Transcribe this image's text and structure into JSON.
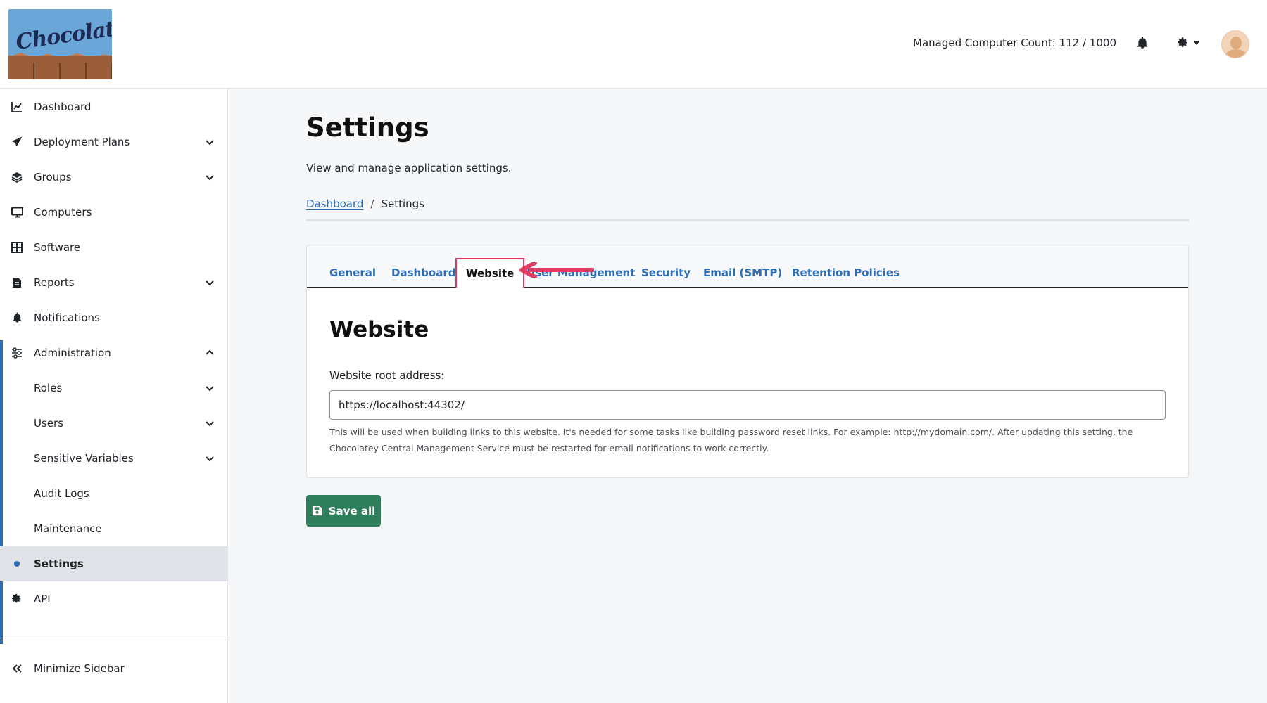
{
  "header": {
    "logo_text": "Chocolatey",
    "managed_count": "Managed Computer Count: 112 / 1000"
  },
  "sidebar": {
    "items": [
      {
        "label": "Dashboard",
        "icon": "chart-line-icon"
      },
      {
        "label": "Deployment Plans",
        "icon": "paper-plane-icon"
      },
      {
        "label": "Groups",
        "icon": "layers-icon"
      },
      {
        "label": "Computers",
        "icon": "desktop-icon"
      },
      {
        "label": "Software",
        "icon": "grid-icon"
      },
      {
        "label": "Reports",
        "icon": "report-file-icon"
      },
      {
        "label": "Notifications",
        "icon": "bell-icon"
      },
      {
        "label": "Administration",
        "icon": "sliders-icon"
      },
      {
        "label": "Roles"
      },
      {
        "label": "Users"
      },
      {
        "label": "Sensitive Variables"
      },
      {
        "label": "Audit Logs"
      },
      {
        "label": "Maintenance"
      },
      {
        "label": "Settings"
      },
      {
        "label": "API",
        "icon": "gear-icon"
      }
    ],
    "minimize_label": "Minimize Sidebar"
  },
  "main": {
    "title": "Settings",
    "subtitle": "View and manage application settings.",
    "breadcrumb": {
      "home": "Dashboard",
      "separator": "/",
      "current": "Settings"
    },
    "tabs": [
      {
        "label": "General"
      },
      {
        "label": "Dashboard"
      },
      {
        "label": "Website"
      },
      {
        "label": "User Management"
      },
      {
        "label": "Security"
      },
      {
        "label": "Email (SMTP)"
      },
      {
        "label": "Retention Policies"
      }
    ],
    "active_tab": "Website",
    "section_title": "Website",
    "field_label": "Website root address:",
    "field_value": "https://localhost:44302/",
    "help_text": "This will be used when building links to this website. It's needed for some tasks like building password reset links. For example: http://mydomain.com/. After updating this setting, the Chocolatey Central Management Service must be restarted for email notifications to work correctly.",
    "save_label": "Save all"
  },
  "colors": {
    "accent": "#2e6db4",
    "save_button": "#2e7d5b",
    "highlight": "#e03b63",
    "active_nav_bg": "#e0e3e7"
  }
}
